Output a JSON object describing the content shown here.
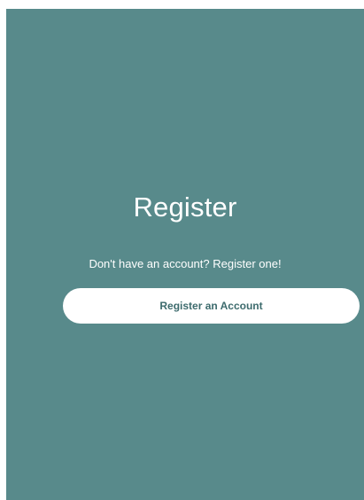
{
  "title": "Register",
  "subtitle": "Don't have an account? Register one!",
  "register_button": "Register an Account",
  "colors": {
    "panel_background": "#588a8b",
    "button_background": "#ffffff",
    "button_text": "#3d6b6d",
    "text": "#ffffff"
  }
}
